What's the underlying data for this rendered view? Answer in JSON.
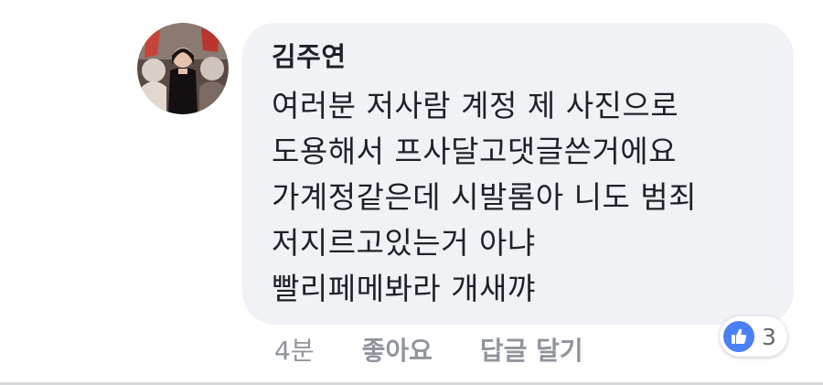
{
  "comment": {
    "author": "김주연",
    "lines": [
      "여러분 저사람 계정 제 사진으로",
      "도용해서 프사달고댓글쓴거에요",
      "가계정같은데 시발롬아 니도 범죄",
      "저지르고있는거 아냐",
      "빨리페메봐라 개새꺄"
    ],
    "timestamp": "4분",
    "like_label": "좋아요",
    "reply_label": "답글 달기",
    "reactions": {
      "icon": "thumbs-up-icon",
      "count": "3"
    }
  },
  "colors": {
    "bubble_bg": "#f1f2f6",
    "text": "#1d2129",
    "meta_text": "#90949c",
    "like_blue": "#4b7ff5"
  }
}
